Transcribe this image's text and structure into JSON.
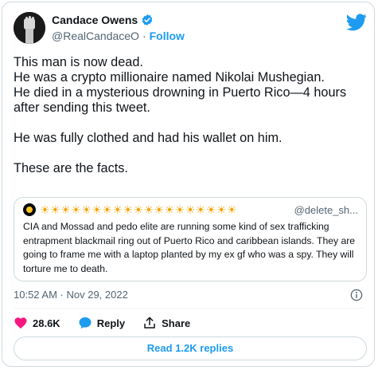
{
  "author": {
    "display_name": "Candace Owens",
    "handle": "@RealCandaceO",
    "separator": "·",
    "follow_label": "Follow",
    "verified_icon": "verified-badge-icon",
    "avatar_icon": "raised-fist-avatar"
  },
  "tweet": {
    "lines": [
      "This man is now dead.",
      "He was a crypto millionaire named Nikolai Mushegian.",
      "He died in a mysterious drowning in Puerto Rico—4 hours after sending this tweet.",
      "He was fully clothed and had his wallet on him.",
      "These are the facts."
    ]
  },
  "quote": {
    "name_emojis": "☀☀☀☀☀☀☀☀☀☀☀☀☀☀☀☀☀☀☀",
    "handle": "@delete_sh...",
    "text": "CIA and Mossad and pedo elite are running some kind of sex trafficking entrapment blackmail ring out of Puerto Rico and caribbean islands. They are going to frame me with a laptop planted by my ex gf who was a spy. They will torture me to death."
  },
  "meta": {
    "timestamp": "10:52 AM · Nov 29, 2022"
  },
  "actions": {
    "like_count": "28.6K",
    "reply_label": "Reply",
    "share_label": "Share"
  },
  "read_replies_label": "Read 1.2K replies",
  "colors": {
    "accent": "#1d9bf0",
    "like": "#f91880",
    "text": "#0f1419",
    "muted": "#536471",
    "border": "#cfd9de"
  }
}
